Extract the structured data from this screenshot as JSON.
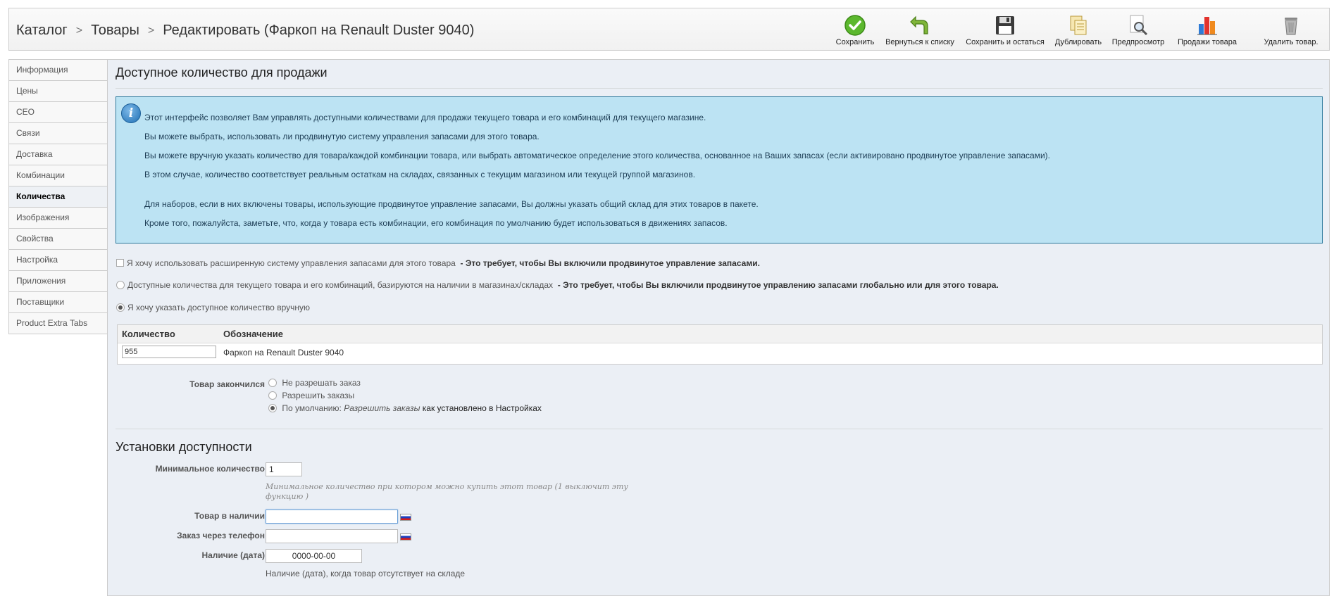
{
  "breadcrumb": {
    "catalog": "Каталог",
    "products": "Товары",
    "edit": "Редактировать (Фаркоп на Renault Duster 9040)"
  },
  "toolbar": {
    "save": "Сохранить",
    "back": "Вернуться к списку",
    "save_stay": "Сохранить и остаться",
    "duplicate": "Дублировать",
    "preview": "Предпросмотр",
    "sales": "Продажи товара",
    "delete": "Удалить товар."
  },
  "sidebar": {
    "items": [
      {
        "label": "Информация"
      },
      {
        "label": "Цены"
      },
      {
        "label": "CEO"
      },
      {
        "label": "Связи"
      },
      {
        "label": "Доставка"
      },
      {
        "label": "Комбинации"
      },
      {
        "label": "Количества",
        "active": true
      },
      {
        "label": "Изображения"
      },
      {
        "label": "Свойства"
      },
      {
        "label": "Настройка"
      },
      {
        "label": "Приложения"
      },
      {
        "label": "Поставщики"
      },
      {
        "label": "Product Extra Tabs"
      }
    ]
  },
  "main": {
    "title": "Доступное количество для продажи",
    "info": [
      "Этот интерфейс позволяет Вам управлять доступными количествами для продажи текущего товара и его комбинаций для текущего магазине.",
      "Вы можете выбрать, использовать ли продвинутую систему управления запасами для этого товара.",
      "Вы можете вручную указать количество для товара/каждой комбинации товара, или выбрать автоматическое определение этого количества, основанное на Ваших запасах (если активировано продвинутое управление запасами).",
      "В этом случае, количество соответствует реальным остаткам на складах, связанных с текущим магазином или текущей группой магазинов.",
      "Для наборов, если в них включены товары, использующие продвинутое управление запасами, Вы должны указать общий склад для этих товаров в пакете.",
      "Кроме того, пожалуйста, заметьте, что, когда у товара есть комбинации, его комбинация по умолчанию будет использоваться в движениях запасов."
    ],
    "options": {
      "advanced": "Я хочу использовать расширенную систему управления запасами для этого товара",
      "advanced_note": "- Это требует, чтобы Вы включили продвинутое управление запасами.",
      "depends": "Доступные количества для текущего товара и его комбинаций, базируются на наличии в магазинах/складах",
      "depends_note": "- Это требует, чтобы Вы включили продвинутое управлению запасами глобально или для этого товара.",
      "manual": "Я хочу указать доступное количество вручную"
    },
    "qty_table": {
      "col_qty": "Количество",
      "col_name": "Обозначение",
      "qty_value": "955",
      "name_value": "Фаркоп на Renault Duster 9040"
    },
    "out_of_stock": {
      "label": "Товар закончился",
      "deny": "Не разрешать заказ",
      "allow": "Разрешить заказы",
      "default_prefix": "По умолчанию:",
      "default_value": "Разрешить заказы",
      "default_suffix": "как установлено в Настройках"
    }
  },
  "availability": {
    "title": "Установки доступности",
    "min_qty_label": "Минимальное количество",
    "min_qty_value": "1",
    "min_qty_hint": "Минимальное количество при котором можно купить этот товар (1 выключит эту функцию )",
    "in_stock_label": "Товар в наличии",
    "in_stock_value": "",
    "phone_label": "Заказ через телефон",
    "phone_value": "",
    "date_label": "Наличие (дата)",
    "date_value": "0000-00-00",
    "date_hint": "Наличие (дата), когда товар отсутствует на складе"
  }
}
